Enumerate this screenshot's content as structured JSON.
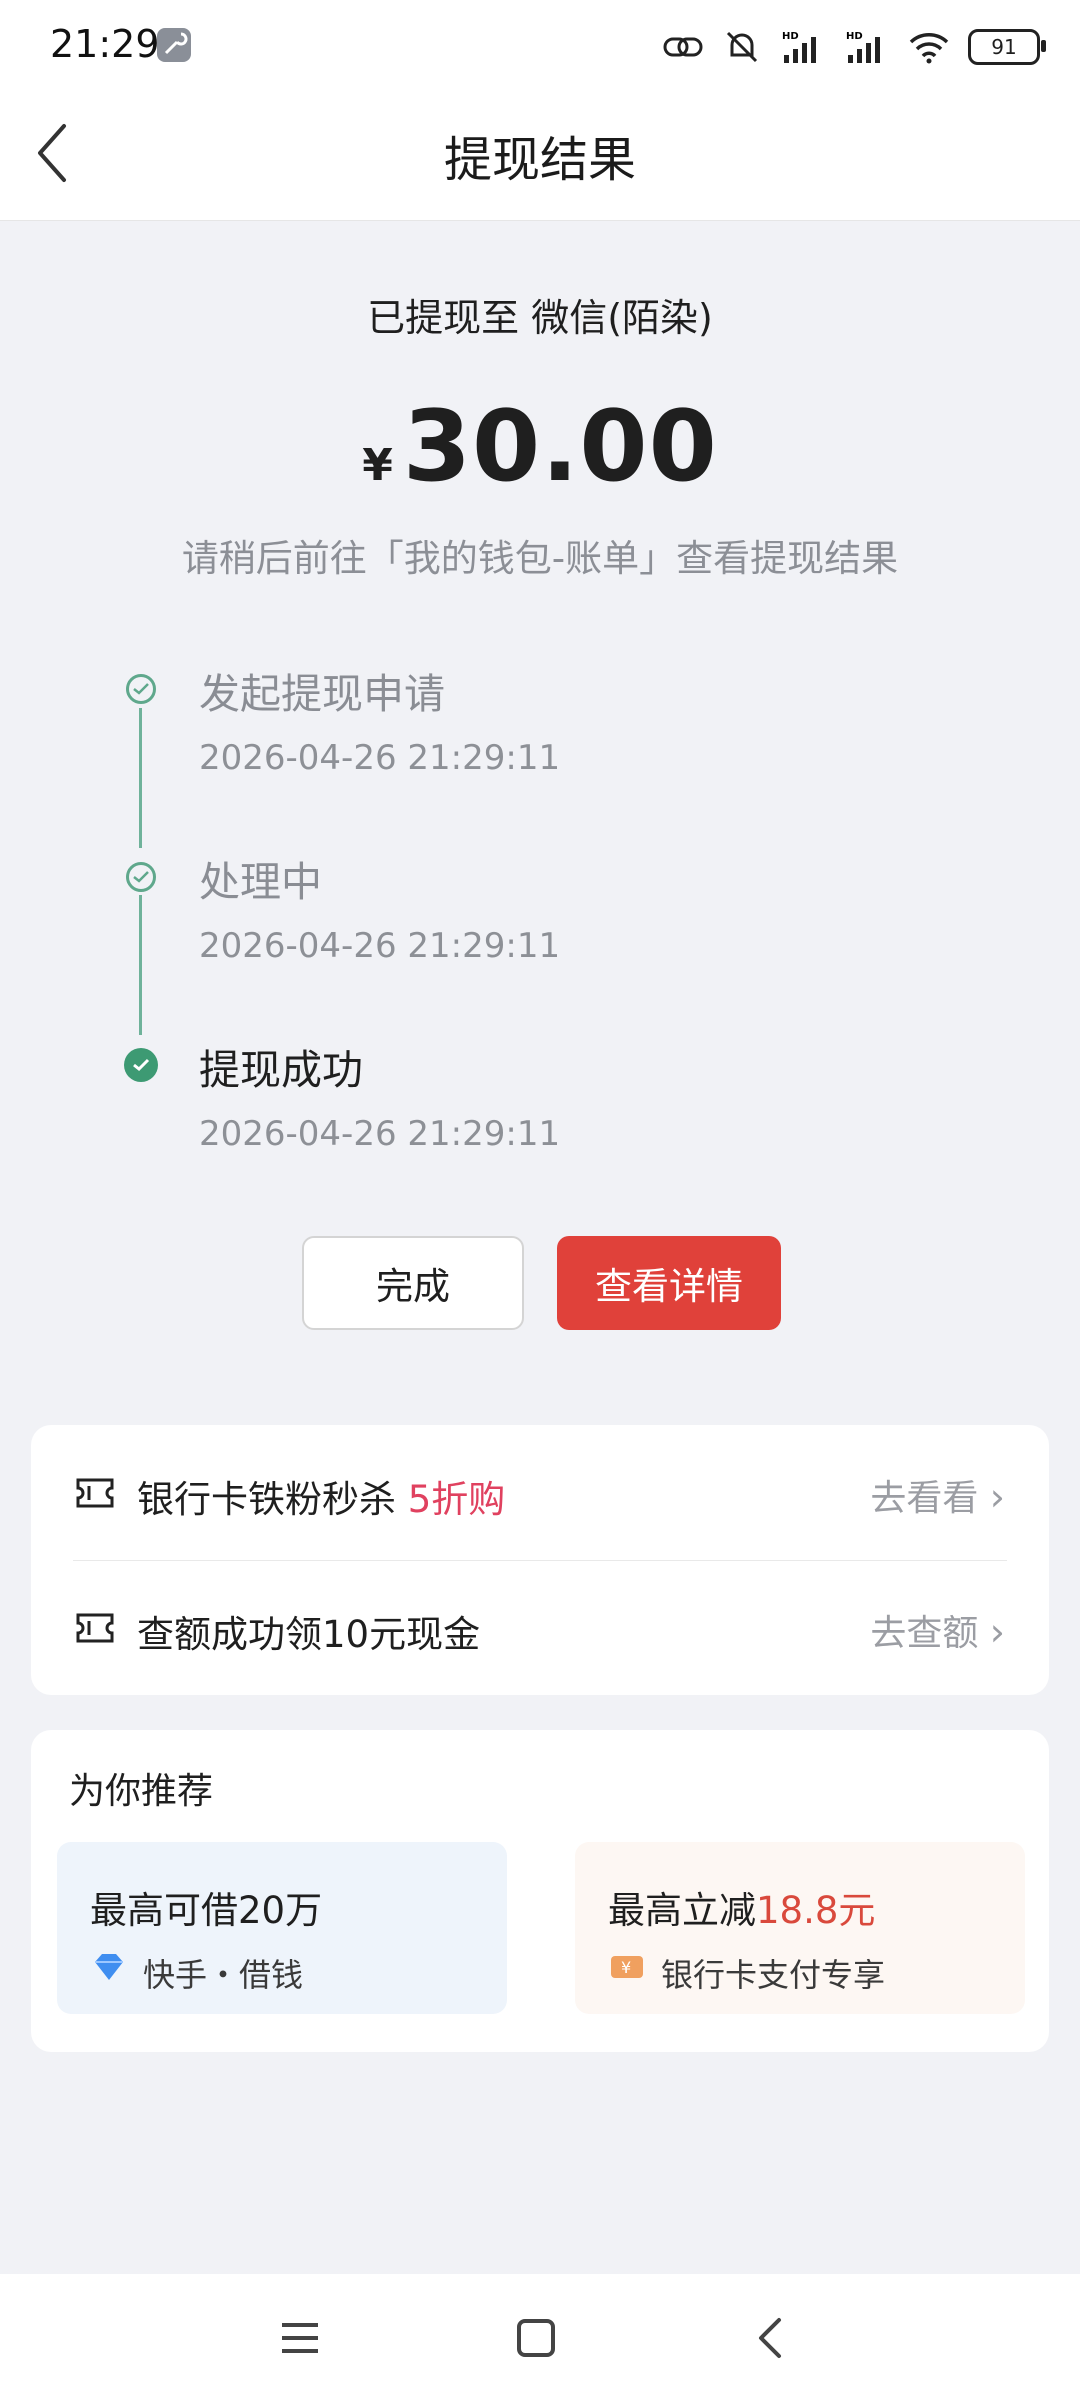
{
  "status_bar": {
    "time": "21:29",
    "battery": "91",
    "icons": [
      "tool-icon",
      "link-icon",
      "mute-icon",
      "signal-hd-icon",
      "signal-hd-icon",
      "wifi-icon",
      "battery-icon"
    ]
  },
  "header": {
    "title": "提现结果",
    "back_icon": "chevron-left-icon"
  },
  "result": {
    "withdraw_to": "已提现至 微信(陌染)",
    "currency": "¥",
    "amount": "30.00",
    "hint": "请稍后前往「我的钱包-账单」查看提现结果"
  },
  "timeline": [
    {
      "title": "发起提现申请",
      "time": "2026-04-26 21:29:11",
      "state": "done-past"
    },
    {
      "title": "处理中",
      "time": "2026-04-26 21:29:11",
      "state": "done-past"
    },
    {
      "title": "提现成功",
      "time": "2026-04-26 21:29:11",
      "state": "current"
    }
  ],
  "buttons": {
    "done": "完成",
    "detail": "查看详情"
  },
  "promo": [
    {
      "text": "银行卡铁粉秒杀 ",
      "highlight": "5折购",
      "link": "去看看",
      "icon": "ticket-icon"
    },
    {
      "text": "查额成功领10元现金",
      "highlight": "",
      "link": "去查额",
      "icon": "ticket-icon"
    }
  ],
  "recommend": {
    "title": "为你推荐",
    "items": [
      {
        "main": "最高可借20万",
        "main_highlight": "",
        "sub": "快手・借钱",
        "icon": "diamond-icon"
      },
      {
        "main": "最高立减",
        "main_highlight": "18.8元",
        "sub": "银行卡支付专享",
        "icon": "yen-coupon-icon"
      }
    ]
  },
  "colors": {
    "accent_red": "#e0413a",
    "success_green": "#3d9a73",
    "highlight_pink": "#e0415f"
  },
  "nav": [
    "menu-icon",
    "home-icon",
    "back-icon"
  ]
}
